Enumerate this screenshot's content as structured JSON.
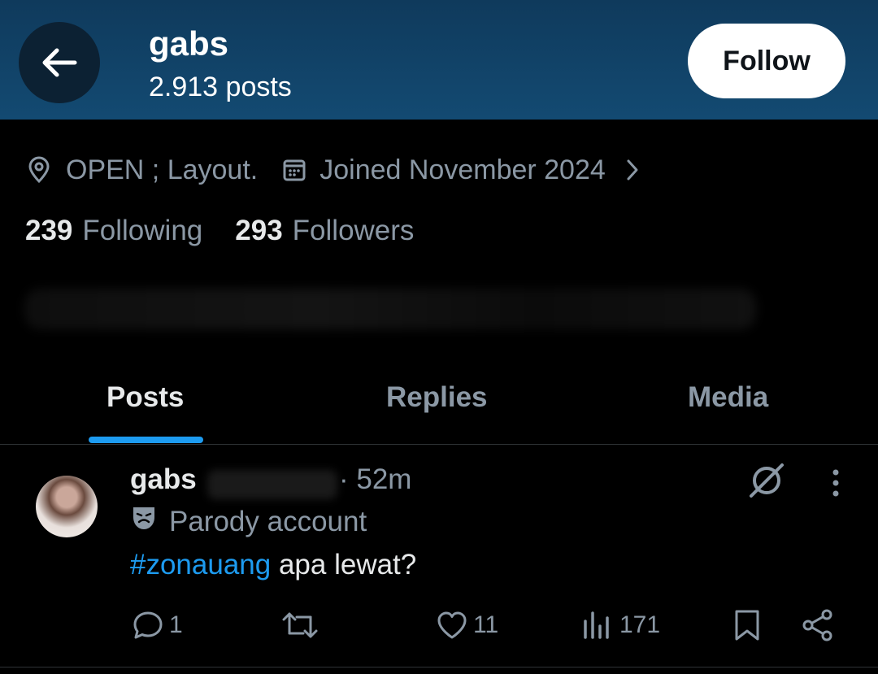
{
  "header": {
    "title": "gabs",
    "post_count": "2.913 posts",
    "follow_label": "Follow"
  },
  "profile": {
    "location": "OPEN ; Layout.",
    "joined": "Joined November 2024",
    "following_count": "239",
    "following_label": "Following",
    "followers_count": "293",
    "followers_label": "Followers"
  },
  "tabs": [
    {
      "label": "Posts",
      "active": true
    },
    {
      "label": "Replies",
      "active": false
    },
    {
      "label": "Media",
      "active": false
    }
  ],
  "post": {
    "author": "gabs",
    "time": "· 52m",
    "badge": "Parody account",
    "hashtag": "#zonauang",
    "text": " apa lewat?",
    "replies": "1",
    "likes": "11",
    "views": "171"
  },
  "colors": {
    "accent": "#1d9bf0",
    "header_bg": "#134a72",
    "muted": "#8b98a5"
  }
}
